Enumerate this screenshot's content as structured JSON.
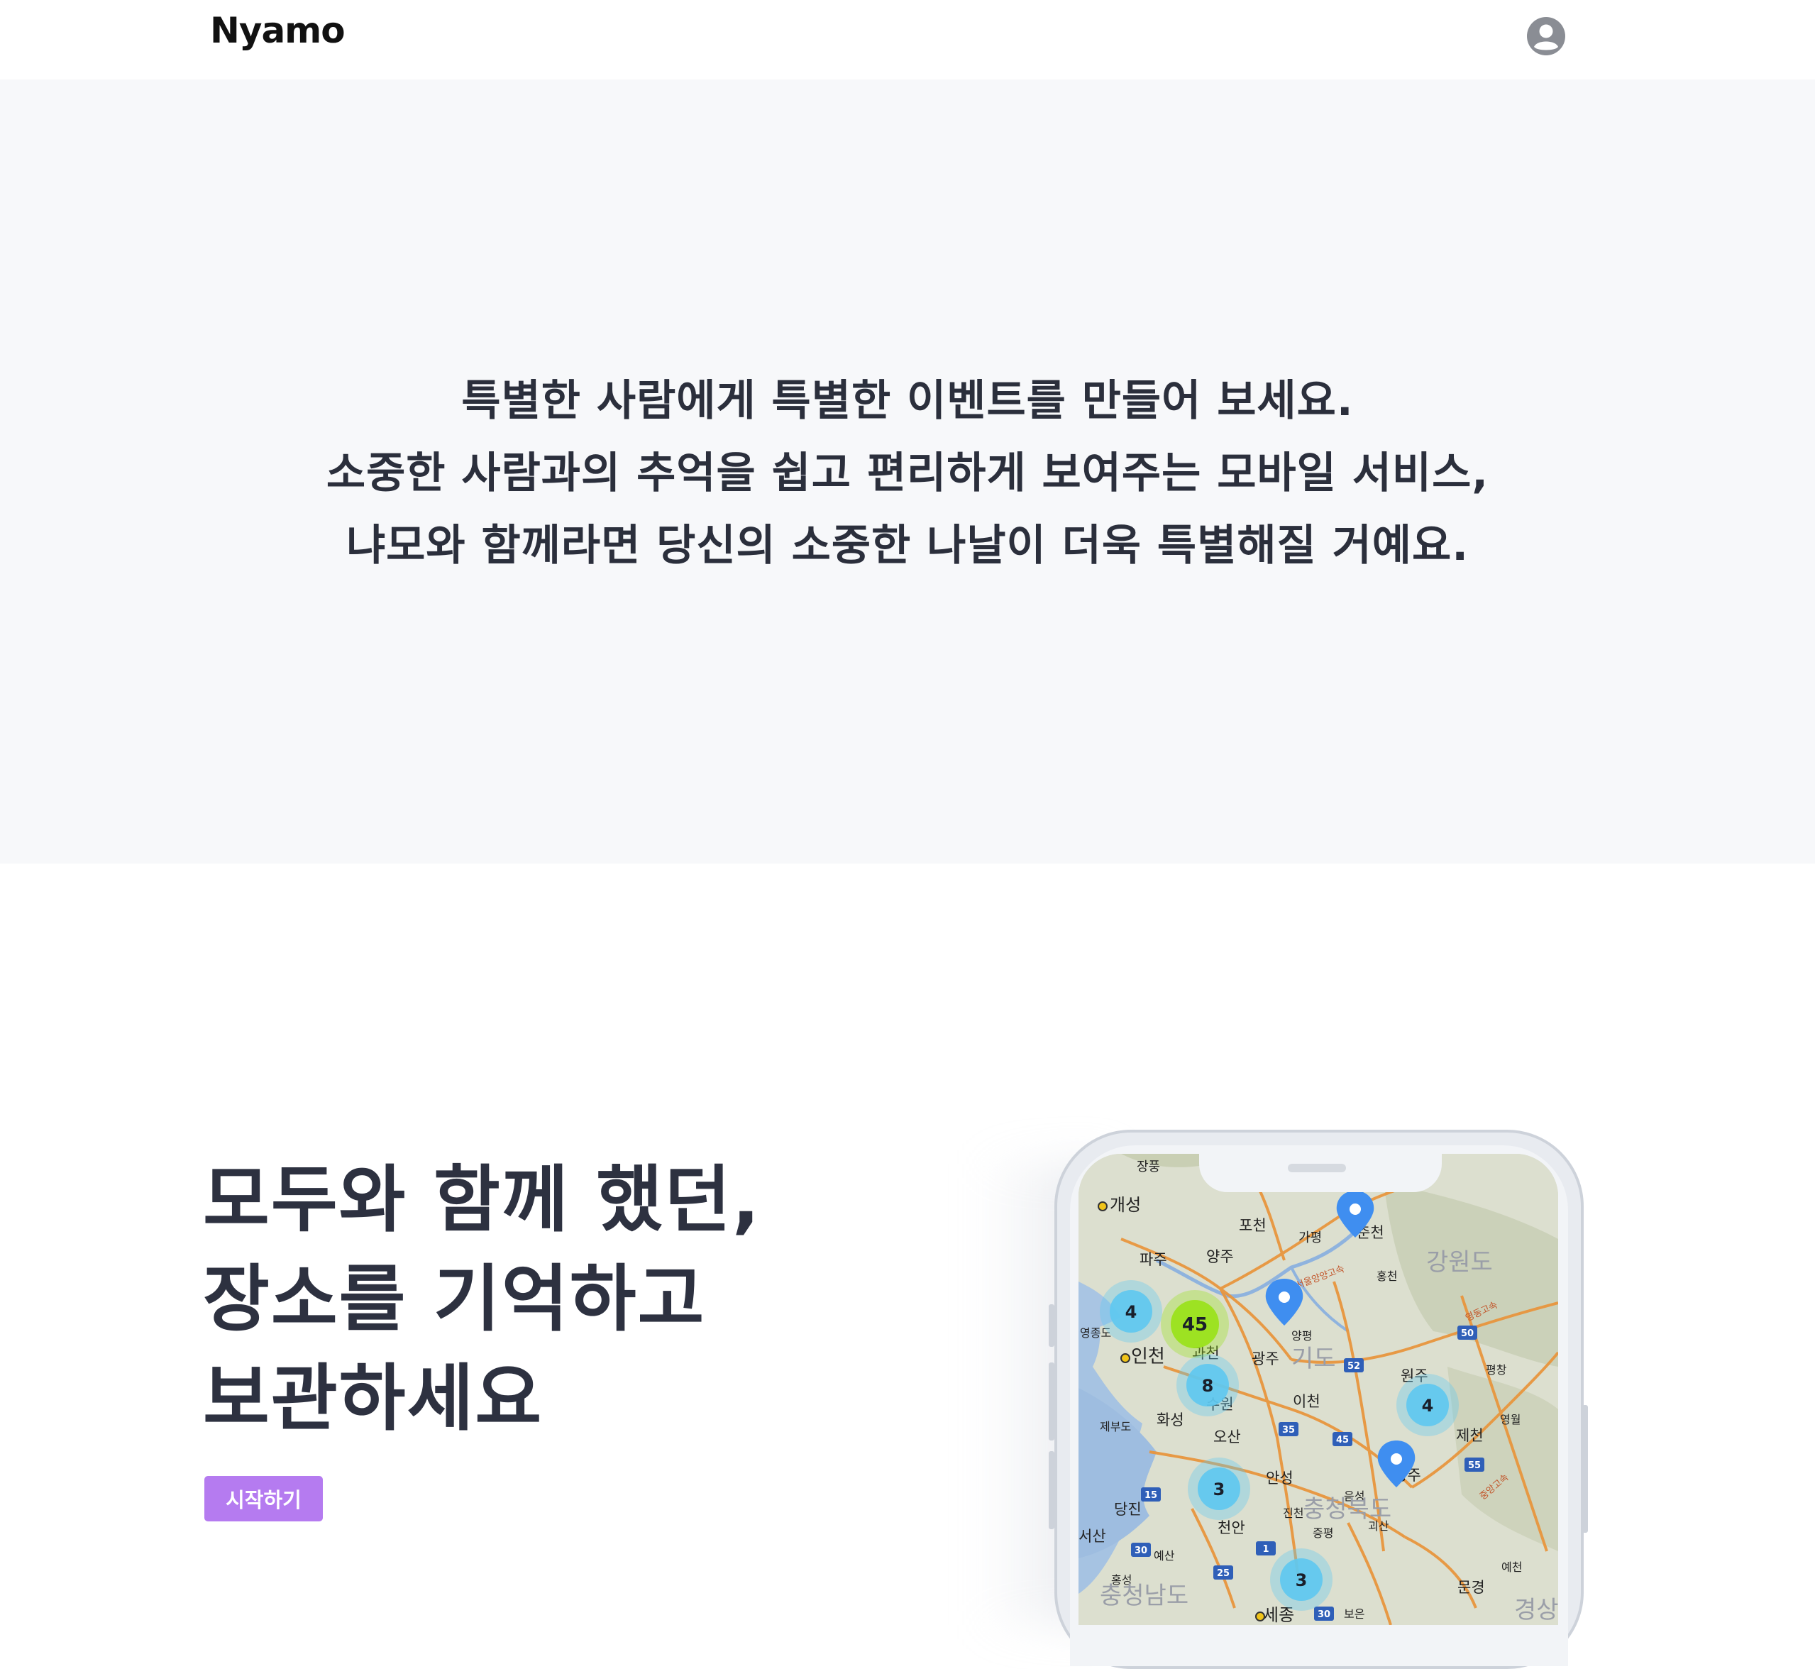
{
  "header": {
    "logo": "Nyamo",
    "account_icon": "user-circle-icon"
  },
  "hero": {
    "lines": [
      "특별한 사람에게 특별한 이벤트를 만들어 보세요.",
      "소중한 사람과의 추억을 쉽고 편리하게 보여주는 모바일 서비스,",
      "냐모와 함께라면 당신의 소중한 나날이 더욱 특별해질 거예요."
    ]
  },
  "feature": {
    "title_lines": [
      "모두와 함께 했던,",
      "장소를 기억하고",
      "보관하세요"
    ],
    "start_button": "시작하기"
  },
  "map": {
    "places": {
      "jangpung": "장풍",
      "gaeseong": "개성",
      "pocheon": "포천",
      "gapyeong": "가평",
      "chuncheon": "춘천",
      "paju": "파주",
      "yangju": "양주",
      "gangwondo": "강원도",
      "hongcheon": "홍천",
      "yeongjongdo": "영종도",
      "incheon": "인천",
      "gwacheon": "과천",
      "gwangju": "광주",
      "yangpyeong": "양평",
      "gyeonggido": "기도",
      "wonju": "원주",
      "pyeongchang": "평창",
      "hwaseong": "화성",
      "suwon": "수원",
      "icheon": "이천",
      "yeongwol": "영월",
      "jecheon": "제천",
      "jebudo": "제부도",
      "osan": "오산",
      "anseong": "안성",
      "chungju": "충주",
      "dangjin": "당진",
      "eumseong": "음성",
      "jincheon": "진천",
      "chungbuk": "충청북도",
      "goesan": "괴산",
      "seosan": "서산",
      "cheonan": "천안",
      "jeungpyeong": "증평",
      "yesan": "예산",
      "yecheon": "예천",
      "hongseong": "홍성",
      "chungnam": "충청남도",
      "sejong": "세종",
      "boeun": "보은",
      "mungyeong": "문경",
      "gyeongsang": "경상"
    },
    "clusters": [
      {
        "count": "4",
        "color": "#5ec8f0"
      },
      {
        "count": "45",
        "color": "#9be21c"
      },
      {
        "count": "8",
        "color": "#5ec8f0"
      },
      {
        "count": "4",
        "color": "#5ec8f0"
      },
      {
        "count": "3",
        "color": "#5ec8f0"
      },
      {
        "count": "3",
        "color": "#5ec8f0"
      }
    ],
    "highway_numbers": [
      "50",
      "52",
      "35",
      "45",
      "55",
      "15",
      "30",
      "25",
      "1",
      "30"
    ],
    "highway_names": [
      "서울양양고속",
      "영동고속",
      "중앙고속"
    ]
  },
  "colors": {
    "accent": "#b57bf0",
    "hero_bg": "#f7f8fa",
    "text": "#2d3140"
  }
}
